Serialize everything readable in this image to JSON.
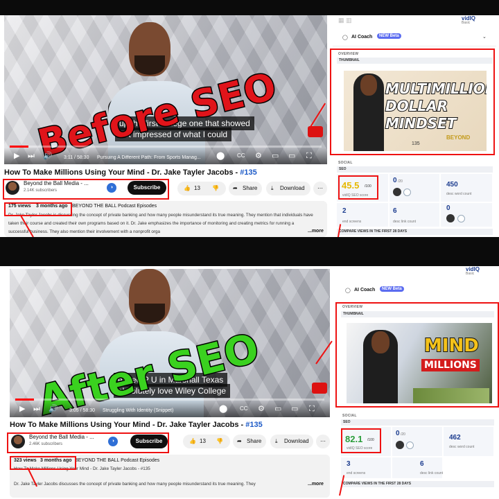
{
  "before": {
    "overlay_text": "Before SEO",
    "caption_line1": "up              the first college one that showed",
    "caption_line2": "        not impressed of what I could",
    "time": "3:11 / 58:30",
    "chapter": "Pursuing A Different Path: From Sports Manag...",
    "video_title": "How To Make Millions Using Your Mind - Dr. Jake Tayler Jacobs - ",
    "episode": "#135",
    "channel_name": "Beyond the Ball Media - ...",
    "subscribers": "2.14K subscribers",
    "subscribe_label": "Subscribe",
    "likes": "13",
    "share_label": "Share",
    "download_label": "Download",
    "views": "175 views",
    "age": "3 months ago",
    "playlist": "BEYOND THE BALL Podcast Episodes",
    "description": "Dr. Jake Tayler Jacobs is discussing the concept of private banking and how many people misunderstand its true meaning. They mention that individuals have taken their course and created their own programs based on it. Dr. Jake emphasizes the importance of monitoring and creating metrics for running a successful business. They also mention their involvement with a nonprofit orga",
    "more": "...more",
    "thumb_text": [
      "MULTIMILLION",
      "DOLLAR",
      "MINDSET"
    ],
    "thumb_brand": "BEYOND",
    "thumb_num": "135",
    "seo_score": "45.5",
    "seo_max": "/100",
    "seo_label": "vidIQ SEO score",
    "score2": "0",
    "score2_max": "/20",
    "word_count": "450",
    "word_label": "desc word count",
    "screens": "2",
    "screens_label": "end screens",
    "links": "6",
    "links_label": "desc link count",
    "zero": "0"
  },
  "after": {
    "overlay_text": "After SEO",
    "caption_line1": "            ended P   U in Marshall Texas",
    "caption_line2": "absolutely love Wiley College",
    "time": "3:05 / 58:30",
    "chapter": "Struggling With Identity (Snippet)",
    "video_title": "How To Make Millions Using Your Mind - Dr. Jake Tayler Jacobs - ",
    "episode": "#135",
    "channel_name": "Beyond the Ball Media - ...",
    "subscribers": "2.46K subscribers",
    "subscribe_label": "Subscribe",
    "likes": "13",
    "share_label": "Share",
    "download_label": "Download",
    "views": "323 views",
    "age": "3 months ago",
    "playlist": "BEYOND THE BALL Podcast Episodes",
    "desc_line1": "How To Make Millions Using Your Mind - Dr. Jake Tayler Jacobs - #135",
    "description": "Dr. Jake Tayler Jacobs discusses the concept of private banking and how many people misunderstand its true meaning. They",
    "more": "...more",
    "thumb_text": [
      "MIND",
      "MILLIONS"
    ],
    "seo_score": "82.1",
    "seo_max": "/100",
    "seo_label": "vidIQ SEO score",
    "score2": "0",
    "score2_max": "/20",
    "word_count": "462",
    "word_label": "desc word count",
    "screens": "3",
    "screens_label": "end screens",
    "links": "6",
    "links_label": "desc link count"
  },
  "sidebar": {
    "ai_coach": "AI Coach",
    "new_badge": "NEW Beta",
    "overview": "OVERVIEW",
    "thumbnail": "THUMBNAIL",
    "social": "SOCIAL",
    "seo": "SEO",
    "compare": "COMPARE VIEWS IN THE FIRST 28 DAYS",
    "basic": "Basic",
    "brand": "vidIQ"
  },
  "colors": {
    "red_highlight": "#e11111",
    "before_text": "#e0141a",
    "after_text": "#3ad11f",
    "score_yellow": "#e6b800",
    "score_green": "#2a9d3a",
    "link_blue": "#1b59c7"
  }
}
